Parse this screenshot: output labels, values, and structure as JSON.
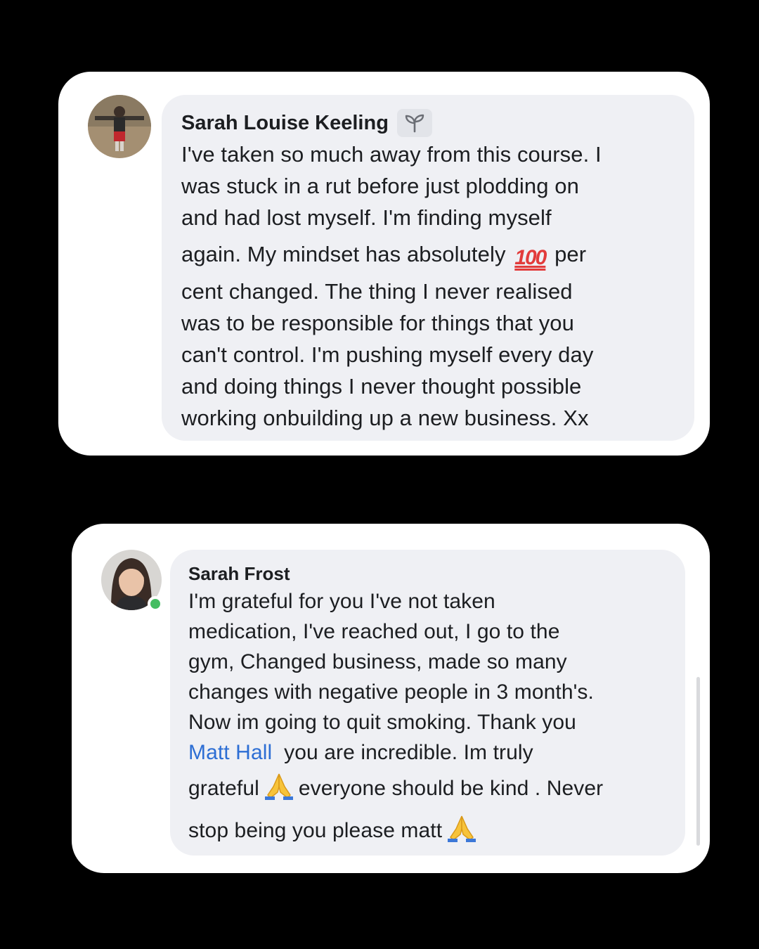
{
  "comments": [
    {
      "author": "Sarah Louise Keeling",
      "badge_icon": "sprout-icon",
      "avatar_icon": "profile-photo",
      "lines": [
        "I've taken so much away from this course. I",
        "was stuck in a rut before just plodding on",
        "and had lost myself. I'm finding myself",
        "again. My mindset has absolutely",
        "per",
        "cent changed. The thing I never realised",
        "was to be responsible for things that you",
        "can't control. I'm pushing myself every day",
        "and doing things I never thought possible",
        "working onbuilding up a new business. Xx"
      ],
      "emoji_100": "100"
    },
    {
      "author": "Sarah Frost",
      "avatar_icon": "profile-photo",
      "online": true,
      "online_color": "#45bd62",
      "lines": [
        "I'm grateful for you I've not taken",
        "medication,  I've reached out, I go to the",
        "gym, Changed business,  made so many",
        "changes with negative people in 3 month's.",
        "Now im going to quit smoking.  Thank you",
        "you are incredible.  Im truly",
        "grateful",
        "everyone should be kind . Never",
        "stop being you please matt"
      ],
      "mention": "Matt Hall",
      "mention_color": "#2d6ed4",
      "emoji_icon": "folded-hands-icon"
    }
  ],
  "colors": {
    "background": "#000000",
    "card": "#ffffff",
    "bubble": "#eff0f4",
    "text": "#1c1e21"
  }
}
